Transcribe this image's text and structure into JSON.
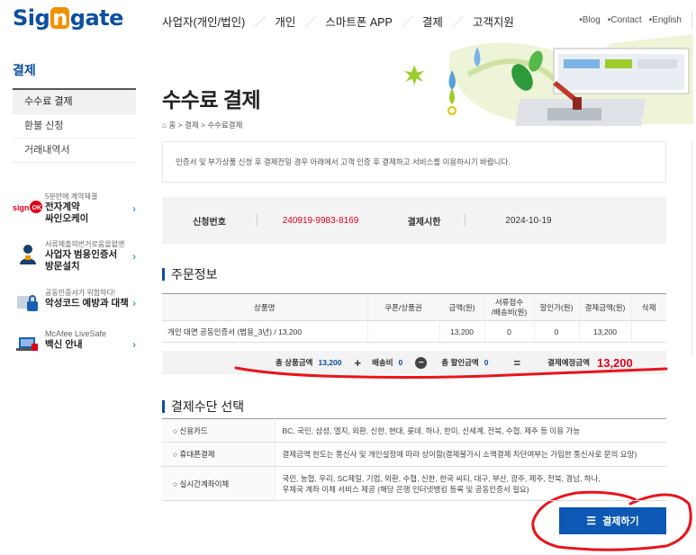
{
  "header": {
    "logo_pre": "Sig",
    "logo_acc": "n",
    "logo_post": "gate",
    "nav": [
      "사업자(개인/법인)",
      "개인",
      "스마트폰 APP",
      "결제",
      "고객지원"
    ],
    "util": [
      "•Blog",
      "•Contact",
      "•English"
    ]
  },
  "sidebar": {
    "title": "결제",
    "items": [
      {
        "label": "수수료 결제"
      },
      {
        "label": "환불 신청"
      },
      {
        "label": "거래내역서"
      }
    ],
    "promos": [
      {
        "small": "5분만에 계약체결",
        "title1": "전자계약",
        "title2": "싸인오케이",
        "icon": "signok-logo-icon",
        "icon_text": "sign OK"
      },
      {
        "small": "서류제출의번거로움을없앤",
        "title1": "사업자 범용인증서",
        "title2": "방문설치",
        "icon": "person-visit-icon"
      },
      {
        "small": "공동인증서가 위험하다!",
        "title1": "악성코드 예방과 대책",
        "title2": "",
        "icon": "shield-lock-icon"
      },
      {
        "small": "McAfee LiveSafe",
        "title1": "백신 안내",
        "title2": "",
        "icon": "mcafee-laptop-icon"
      }
    ]
  },
  "page": {
    "title": "수수료 결제",
    "breadcrumb": "홈 > 결제 > 수수료결제",
    "notice": "인증서 및 부가상품 신청 후 결제전일 경우 아래에서 고객 인증 후 결제하고 서비스를 이용하시기 바랍니다."
  },
  "application": {
    "no_label": "신청번호",
    "no_value": "240919-9983-8169",
    "deadline_label": "결제시한",
    "deadline_value": "2024-10-19"
  },
  "order": {
    "section_title": "주문정보",
    "headers": [
      "상품명",
      "쿠폰/상품권",
      "금액(원)",
      "서류접수\n/배송비(원)",
      "할인가(원)",
      "결제금액(원)",
      "삭제"
    ],
    "rows": [
      [
        "개인 대면 공동인증서 (범용_3년) / 13,200",
        "",
        "13,200",
        "0",
        "0",
        "13,200",
        ""
      ]
    ],
    "summary": {
      "total_label": "총 상품금액",
      "total_value": "13,200",
      "plus": "+",
      "shipping_label": "배송비",
      "shipping_value": "0",
      "minus": "−",
      "discount_label": "총 할인금액",
      "discount_value": "0",
      "equals": "=",
      "final_label": "결제예정금액",
      "final_value": "13,200"
    }
  },
  "payment": {
    "section_title": "결제수단 선택",
    "methods": [
      {
        "label": "신용카드",
        "desc": "BC, 국민, 삼성, 엘지, 외환, 신한, 현대, 롯데, 하나, 한미, 신세계, 전북, 수협, 제주 등 이용 가능"
      },
      {
        "label": "휴대폰결제",
        "desc": "결제금액 한도는 통신사 및 개인설정에 따라 상이함(결제불가시 소액결제 차단여부는 가입한 통신사로 문의 요망)"
      },
      {
        "label": "실시간계좌이체",
        "desc": "국민, 농협, 우리, SC제일, 기업, 외환, 수협, 신한, 한국 씨티, 대구, 부산, 광주, 제주, 전북, 경남, 하나,",
        "desc2": "우체국 계좌 이체 서비스 제공 (해당 은행 인터넷뱅킹 등록 및 공동인증서 필요)"
      }
    ],
    "button": "결제하기"
  },
  "colors": {
    "brand": "#0c4ea2",
    "accent": "#f29100",
    "alert": "#e0001b",
    "button": "#0c58b4",
    "scribble": "#e8141c"
  }
}
